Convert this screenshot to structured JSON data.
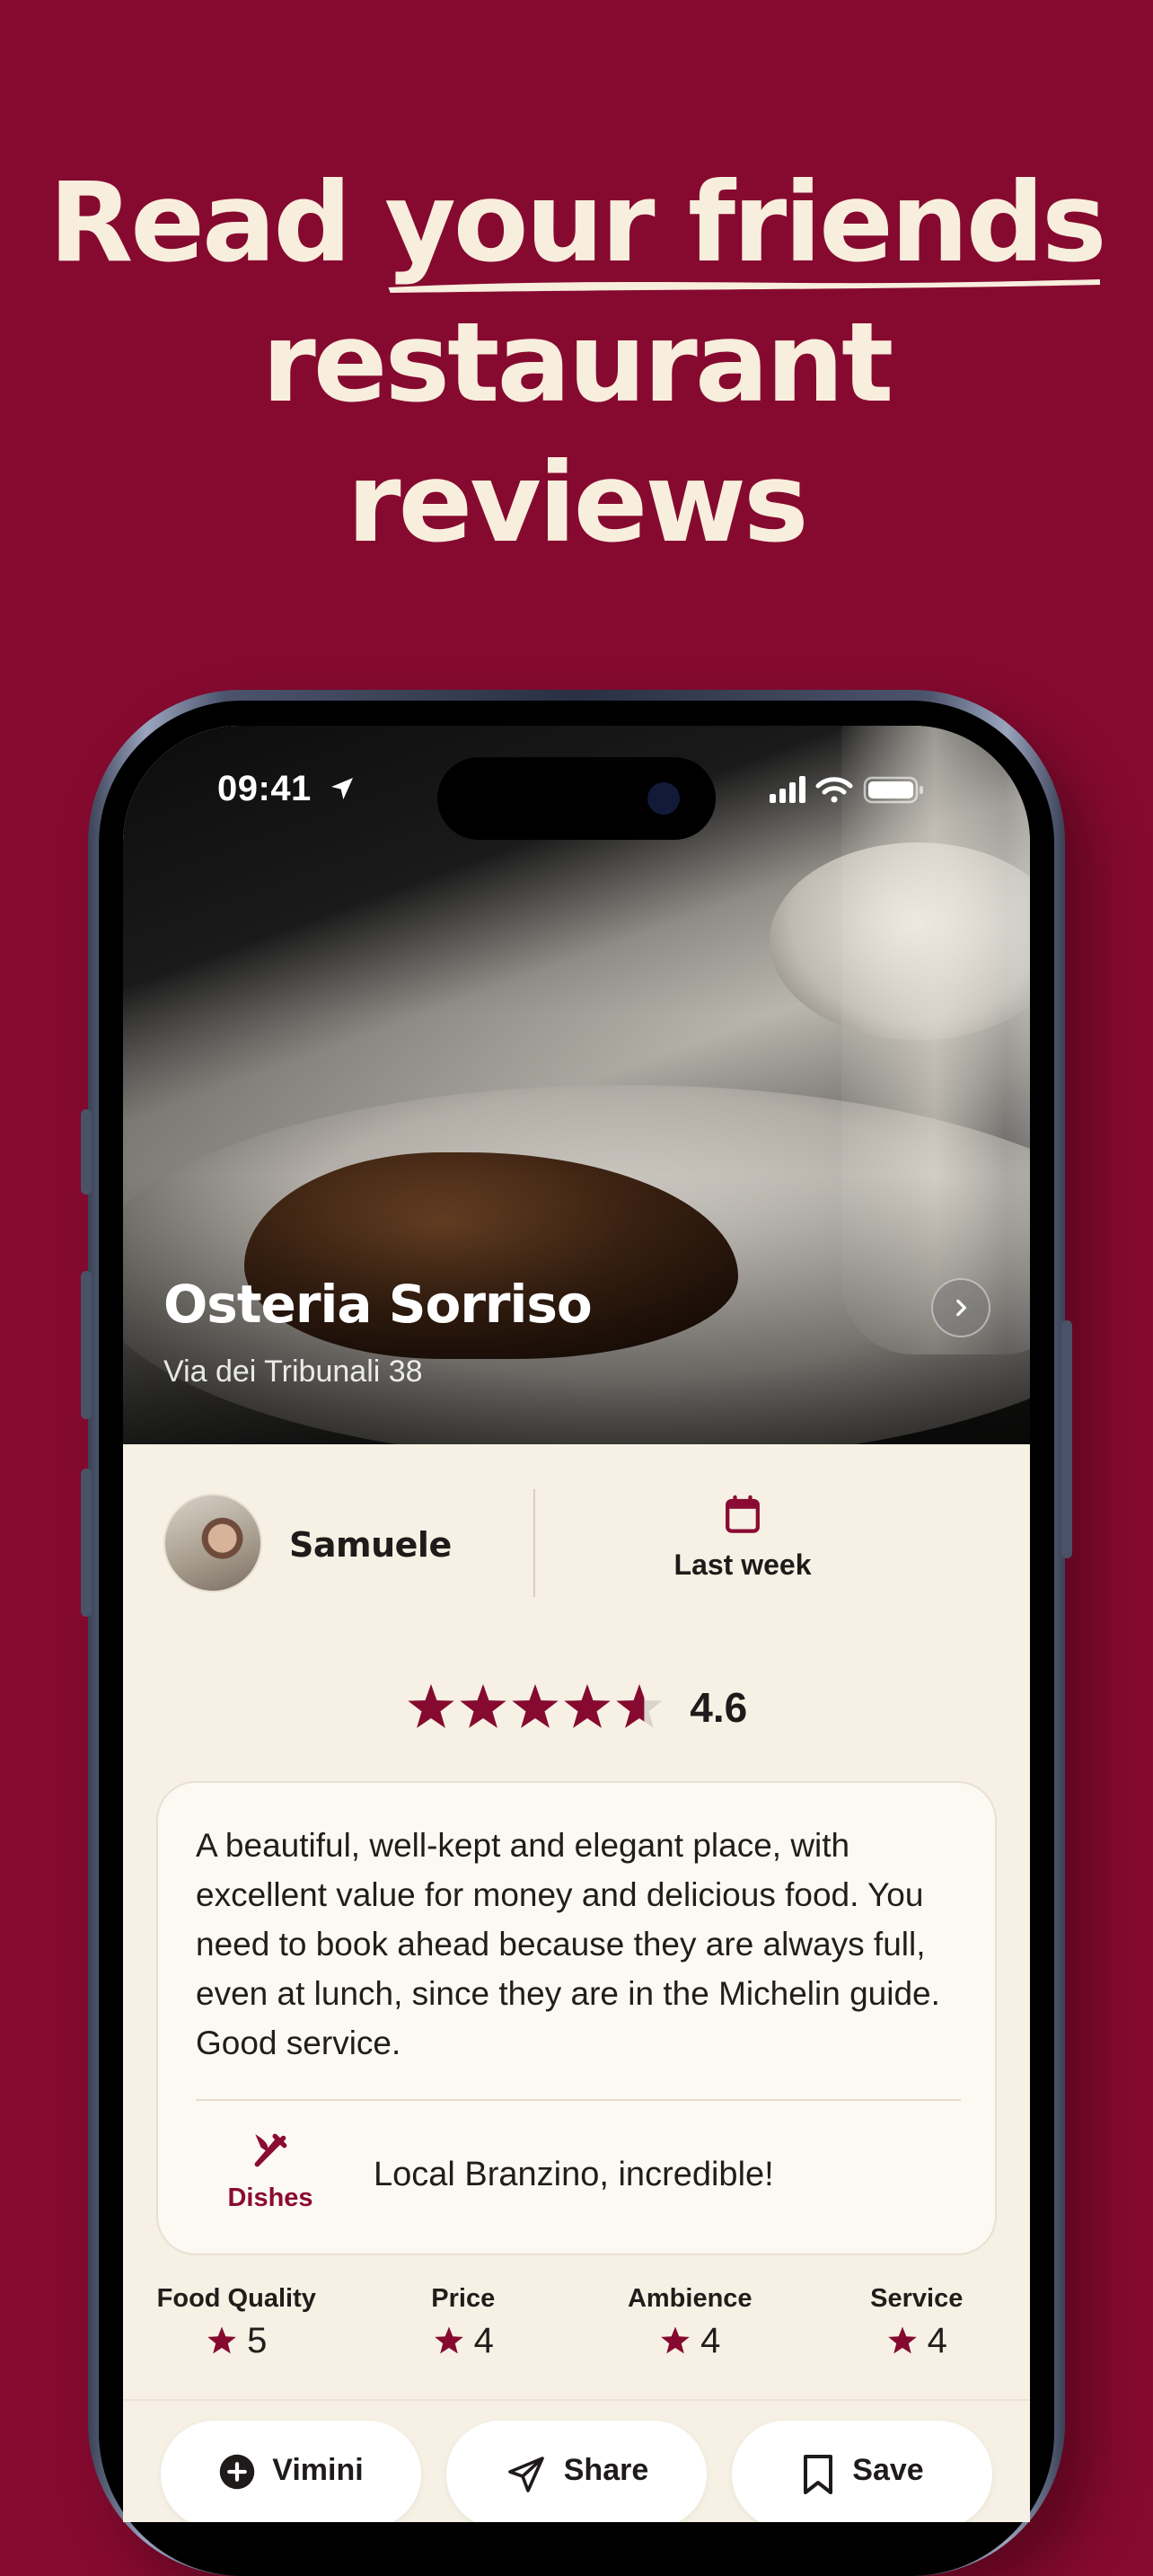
{
  "headline": {
    "line1_prefix": "Read ",
    "line1_emphasis": "your",
    "line1_suffix": " friends",
    "line2": "restaurant",
    "line3": "reviews"
  },
  "status_bar": {
    "time": "09:41"
  },
  "restaurant": {
    "name": "Osteria Sorriso",
    "address": "Via dei Tribunali 38"
  },
  "review": {
    "author": "Samuele",
    "date_label": "Last week",
    "rating": "4.6",
    "rating_fraction": 0.92,
    "text": "A beautiful, well-kept and elegant place, with excellent value for money and delicious food. You need to book ahead because they are always full, even at lunch, since they are in the Michelin guide. Good service.",
    "dishes_label": "Dishes",
    "dish_text": "Local Branzino, incredible!"
  },
  "scores": [
    {
      "label": "Food Quality",
      "value": "5"
    },
    {
      "label": "Price",
      "value": "4"
    },
    {
      "label": "Ambience",
      "value": "4"
    },
    {
      "label": "Service",
      "value": "4"
    }
  ],
  "actions": {
    "vimini": "Vimini",
    "share": "Share",
    "save": "Save"
  },
  "colors": {
    "brand": "#860A30",
    "accent": "#8A0B33",
    "cream": "#F6F1E4",
    "headline_text": "#F8EEDD"
  },
  "icons": {
    "location": "location-arrow-icon",
    "signal": "cellular-signal-icon",
    "wifi": "wifi-icon",
    "battery": "battery-icon",
    "next": "chevron-right-icon",
    "calendar": "calendar-icon",
    "star": "star-icon",
    "dishes": "fork-knife-icon",
    "plus": "plus-circle-icon",
    "share": "paper-plane-icon",
    "save": "bookmark-icon"
  }
}
